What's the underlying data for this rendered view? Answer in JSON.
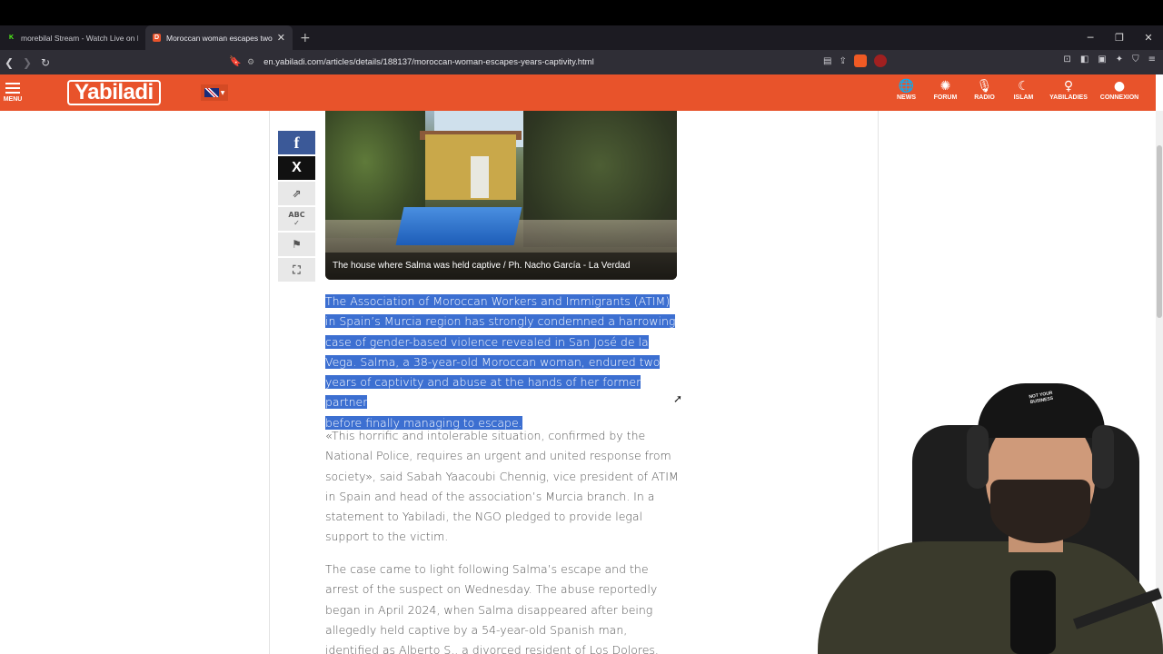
{
  "browser": {
    "tabs": [
      {
        "title": "morebilal Stream - Watch Live on Kick",
        "active": false,
        "favicon": "kick-icon"
      },
      {
        "title": "Moroccan woman escapes two years of captivity",
        "active": true,
        "favicon": "yabiladi-icon"
      }
    ],
    "new_tab_label": "+",
    "url": "en.yabiladi.com/articles/details/188137/moroccan-woman-escapes-years-captivity.html"
  },
  "site": {
    "logo_text": "Yabiladi",
    "menu_label": "MENU",
    "nav": [
      {
        "label": "NEWS",
        "icon": "globe-icon"
      },
      {
        "label": "FORUM",
        "icon": "forum-icon"
      },
      {
        "label": "RADIO",
        "icon": "microphone-icon"
      },
      {
        "label": "ISLAM",
        "icon": "crescent-icon"
      },
      {
        "label": "YABILADIES",
        "icon": "woman-icon"
      },
      {
        "label": "CONNEXION",
        "icon": "user-icon"
      }
    ],
    "accent_color": "#e8532b"
  },
  "share": {
    "facebook": "f",
    "x": "X",
    "abc": "ABC"
  },
  "article": {
    "photo_caption": "The house where Salma was held captive / Ph. Nacho García - La Verdad",
    "lead": [
      "The Association of Moroccan Workers and Immigrants (ATIM)",
      "in Spain’s Murcia region has strongly condemned a harrowing",
      "case of gender-based violence revealed in San José de la",
      "Vega. Salma, a 38-year-old Moroccan woman, endured two",
      "years of captivity and abuse at the hands of her former partner",
      "before finally managing to escape."
    ],
    "paragraph2": "«This horrific and intolerable situation, confirmed by the National Police, requires an urgent and united response from society», said Sabah Yaacoubi Chennig, vice president of ATIM in Spain and head of the association’s Murcia branch. In a statement to Yabiladi, the NGO pledged to provide legal support to the victim.",
    "paragraph3": "The case came to light following Salma’s escape and the arrest of the suspect on Wednesday. The abuse reportedly began in April 2024, when Salma disappeared after being allegedly held captive by a 54-year-old Spanish man, identified as Alberto S., a divorced resident of Los Dolores."
  },
  "webcam": {
    "cap_text": "NOT YOUR BUSINESS"
  }
}
